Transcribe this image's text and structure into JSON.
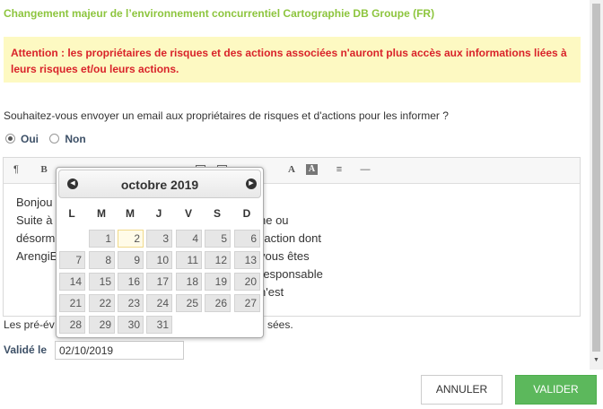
{
  "dialog": {
    "title": "Changement majeur de l’environnement concurrentiel Cartographie DB Groupe (FR)",
    "warning_line1": "Attention : les propriétaires de risques et des actions associées n'auront plus accès aux informations liées à",
    "warning_line2": "leurs risques et/ou leurs actions.",
    "question": "Souhaitez-vous envoyer un email aux propriétaires de risques et d'actions pour les informer ?",
    "radio_yes": "Oui",
    "radio_no": "Non",
    "radio_selected": "Oui",
    "note": "Les pré-év",
    "note_tail": "sées.",
    "valide_label": "Validé le",
    "valide_value": "02/10/2019",
    "cancel_label": "ANNULER",
    "ok_label": "VALIDER"
  },
  "editor": {
    "toolbar": {
      "paragraph": "¶",
      "bold": "B",
      "italic": "I",
      "text_color": "A",
      "bg_color": "A",
      "hr": "—"
    },
    "lines": [
      {
        "visible": "Bonjou",
        "tail": ""
      },
      {
        "visible": "Suite à",
        "tail": "ne ou l'action dont vous êtes responsable n'est"
      },
      {
        "visible": "désorm",
        "tail": ""
      },
      {
        "visible": "ArengiE",
        "tail": ""
      }
    ]
  },
  "calendar": {
    "month_label": "octobre 2019",
    "weekdays": [
      "L",
      "M",
      "M",
      "J",
      "V",
      "S",
      "D"
    ],
    "weeks": [
      [
        "",
        "1",
        "2",
        "3",
        "4",
        "5",
        "6"
      ],
      [
        "7",
        "8",
        "9",
        "10",
        "11",
        "12",
        "13"
      ],
      [
        "14",
        "15",
        "16",
        "17",
        "18",
        "19",
        "20"
      ],
      [
        "21",
        "22",
        "23",
        "24",
        "25",
        "26",
        "27"
      ],
      [
        "28",
        "29",
        "30",
        "31",
        "",
        "",
        ""
      ]
    ],
    "today": "2"
  },
  "colors": {
    "title_green": "#8dc53e",
    "warning_red": "#d9232a",
    "warning_bg": "#fdf9c2",
    "ok_button": "#5cb85c"
  }
}
